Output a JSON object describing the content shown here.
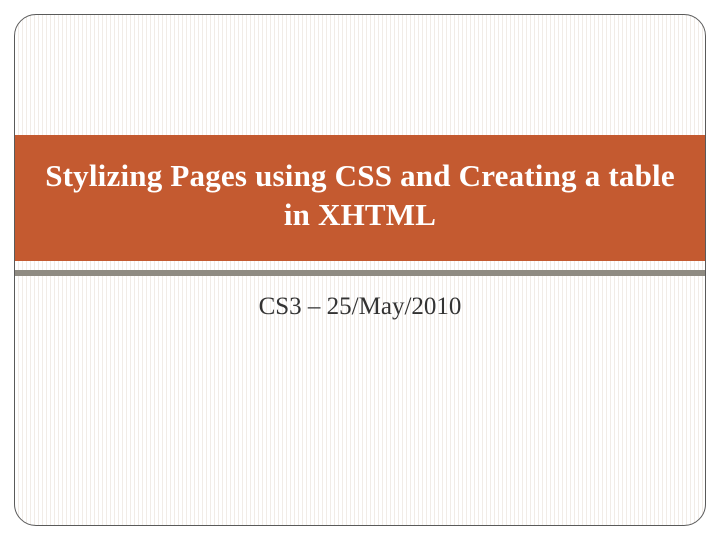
{
  "slide": {
    "title": "Stylizing Pages using CSS and Creating a table in XHTML",
    "subtitle": "CS3 – 25/May/2010"
  },
  "colors": {
    "title_band": "#c45a30",
    "divider": "#8f8b82",
    "frame_border": "#5a5a5a"
  }
}
